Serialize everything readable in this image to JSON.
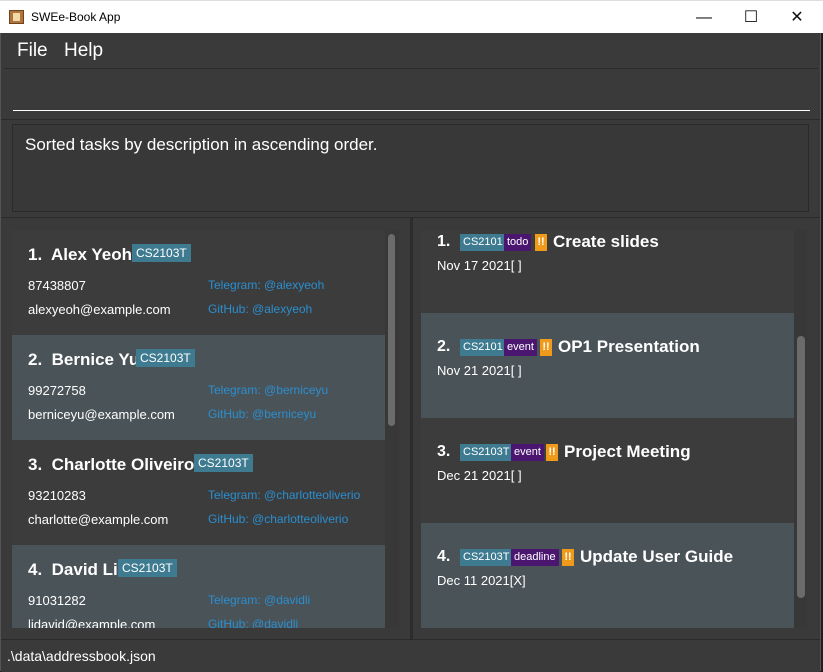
{
  "window": {
    "title": "SWEe-Book App",
    "controls": {
      "minimize": "—",
      "maximize": "☐",
      "close": "✕"
    }
  },
  "menu": {
    "file": "File",
    "help": "Help"
  },
  "command": {
    "value": "",
    "placeholder": ""
  },
  "result": {
    "message": "Sorted tasks by description in ascending order."
  },
  "persons": [
    {
      "index": "1.",
      "name": "Alex Yeoh",
      "tag": "CS2103T",
      "phone": "87438807",
      "email": "alexyeoh@example.com",
      "telegram": "Telegram: @alexyeoh",
      "github": "GitHub: @alexyeoh"
    },
    {
      "index": "2.",
      "name": "Bernice Yu",
      "tag": "CS2103T",
      "phone": "99272758",
      "email": "berniceyu@example.com",
      "telegram": "Telegram: @berniceyu",
      "github": "GitHub: @berniceyu"
    },
    {
      "index": "3.",
      "name": "Charlotte Oliveiro",
      "tag": "CS2103T",
      "phone": "93210283",
      "email": "charlotte@example.com",
      "telegram": "Telegram: @charlotteoliverio",
      "github": "GitHub: @charlotteoliverio"
    },
    {
      "index": "4.",
      "name": "David Li",
      "tag": "CS2103T",
      "phone": "91031282",
      "email": "lidavid@example.com",
      "telegram": "Telegram: @davidli",
      "github": "GitHub: @davidli"
    }
  ],
  "tasks": [
    {
      "index": "1.",
      "module": "CS2101",
      "type": "todo",
      "priority": "!!",
      "description": "Create slides",
      "date": "Nov 17 2021",
      "status": "[ ]"
    },
    {
      "index": "2.",
      "module": "CS2101",
      "type": "event",
      "priority": "!!",
      "description": "OP1 Presentation",
      "date": "Nov 21 2021",
      "status": "[ ]"
    },
    {
      "index": "3.",
      "module": "CS2103T",
      "type": "event",
      "priority": "!!",
      "description": "Project Meeting",
      "date": "Dec 21 2021",
      "status": "[ ]"
    },
    {
      "index": "4.",
      "module": "CS2103T",
      "type": "deadline",
      "priority": "!!",
      "description": "Update User Guide",
      "date": "Dec 11 2021",
      "status": "[X]"
    }
  ],
  "status_bar": {
    "path": ".\\data\\addressbook.json"
  },
  "colors": {
    "background": "#3a3a3a",
    "card_alt": "#4a5357",
    "tag": "#3e7b91",
    "type_tag": "#4b1670",
    "priority": "#f09a1b",
    "link": "#2a8fd0"
  }
}
